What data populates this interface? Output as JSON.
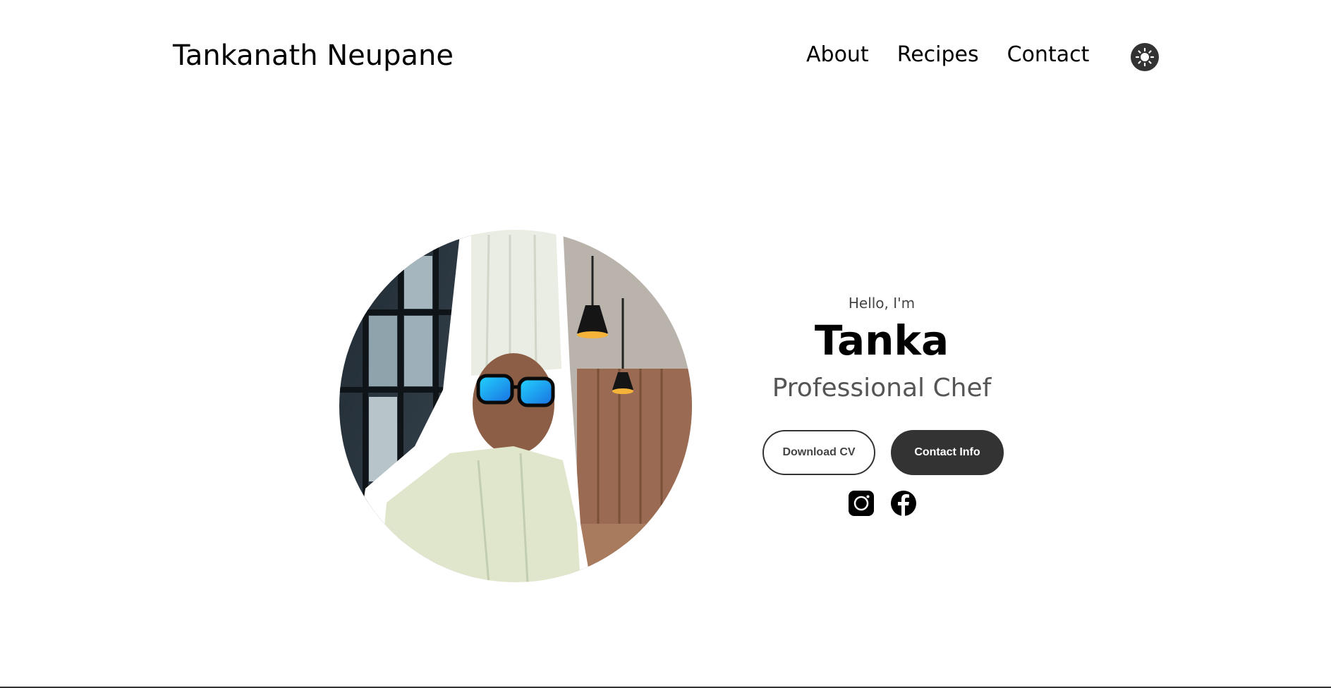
{
  "navbar": {
    "logo": "Tankanath Neupane",
    "links": [
      {
        "label": "About"
      },
      {
        "label": "Recipes"
      },
      {
        "label": "Contact"
      }
    ],
    "theme_toggle_icon": "sun-icon"
  },
  "hero": {
    "greeting": "Hello, I'm",
    "name": "Tanka",
    "title": "Professional Chef",
    "buttons": {
      "download_cv": "Download CV",
      "contact_info": "Contact Info"
    },
    "socials": [
      "instagram-icon",
      "facebook-icon"
    ],
    "photo_alt": "Profile picture"
  },
  "colors": {
    "dark": "#333333",
    "text": "#000000",
    "muted": "#555555",
    "background": "#ffffff"
  }
}
